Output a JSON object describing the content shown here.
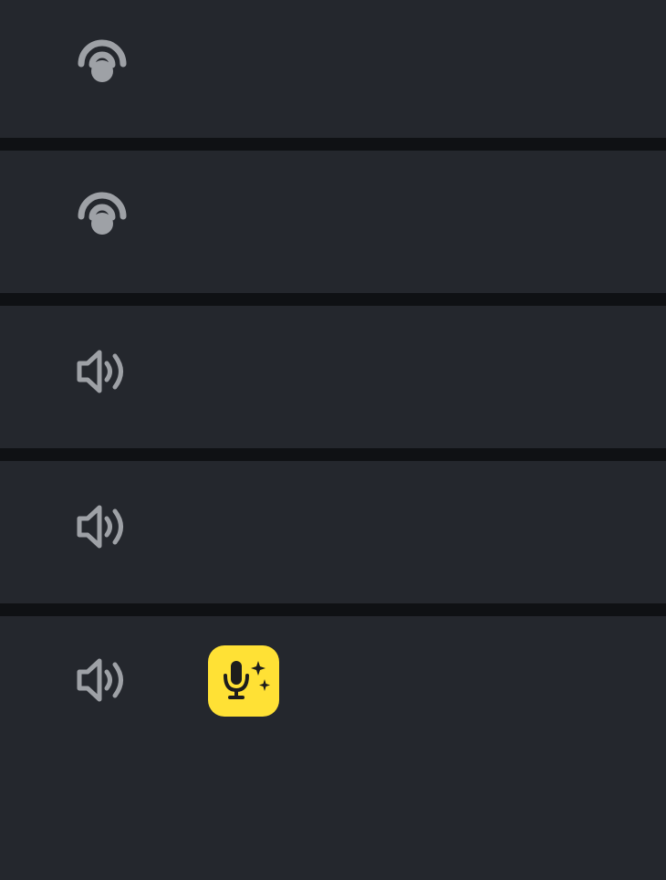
{
  "rows": [
    {
      "icon": "hearing-icon",
      "kind": "listening"
    },
    {
      "icon": "hearing-icon",
      "kind": "listening"
    },
    {
      "icon": "speaker-icon",
      "kind": "audio"
    },
    {
      "icon": "speaker-icon",
      "kind": "audio"
    },
    {
      "icon": "speaker-icon",
      "kind": "audio",
      "extra_button_icon": "ai-voice-mic-sparkle-icon"
    }
  ],
  "colors": {
    "page_background": "#0f1114",
    "row_background": "#24272d",
    "icon_gray": "#9ea1a6",
    "ai_button_yellow": "#ffe135",
    "ai_icon_dark": "#1d1d1d"
  }
}
